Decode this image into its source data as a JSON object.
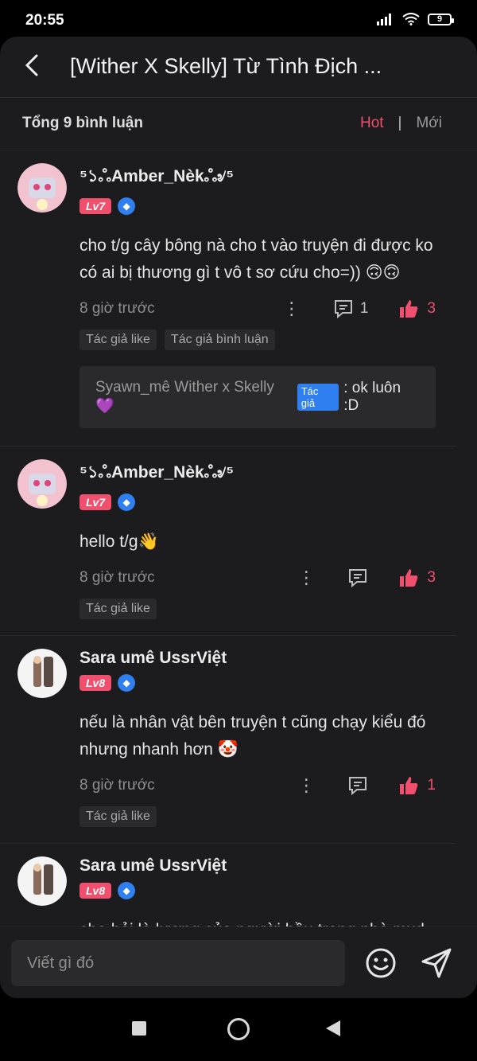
{
  "status": {
    "time": "20:55",
    "battery": "9"
  },
  "header": {
    "title": "[Wither X Skelly] Từ Tình Địch ..."
  },
  "subheader": {
    "count": "Tổng 9 bình luận",
    "sort_hot": "Hot",
    "separator": "|",
    "sort_new": "Mới"
  },
  "comments": [
    {
      "username": "⁵১ஃAmber_Nèkஃ৶⁵",
      "level": "Lv7",
      "content": "cho t/g cây bông nà cho t vào truyện đi được ko có ai bị thương gì t vô t sơ cứu cho=)) 🙃🙃",
      "time": "8 giờ trước",
      "reply_count": "1",
      "like_count": "3",
      "tags": [
        "Tác giả like",
        "Tác giả bình luận"
      ],
      "reply": {
        "user": "Syawn_mê Wither x Skelly💜",
        "badge": "Tác giả",
        "text": ": ok luôn :D"
      }
    },
    {
      "username": "⁵১ஃAmber_Nèkஃ৶⁵",
      "level": "Lv7",
      "content": "hello t/g👋",
      "time": "8 giờ trước",
      "like_count": "3",
      "tags": [
        "Tác giả like"
      ]
    },
    {
      "username": "Sara umê UssrViệt",
      "level": "Lv8",
      "content": "nếu là nhân vật bên truyện t cũng chạy kiểu đó nhưng nhanh hơn 🤡",
      "time": "8 giờ trước",
      "like_count": "1",
      "tags": [
        "Tác giả like"
      ]
    },
    {
      "username": "Sara umê UssrViệt",
      "level": "Lv8",
      "content": "cho hỏi là lương của người hầu trong nhà mxd"
    }
  ],
  "input": {
    "placeholder": "Viết gì đó"
  },
  "icons": {
    "back": "chevron-left-icon",
    "reply": "comment-icon",
    "like": "thumbs-up-icon",
    "more": "more-vertical-icon",
    "emoji": "smiley-icon",
    "send": "send-icon"
  },
  "colors": {
    "accent": "#f0506e",
    "badge_blue": "#2f7ff0",
    "surface": "#1c1c1e"
  }
}
